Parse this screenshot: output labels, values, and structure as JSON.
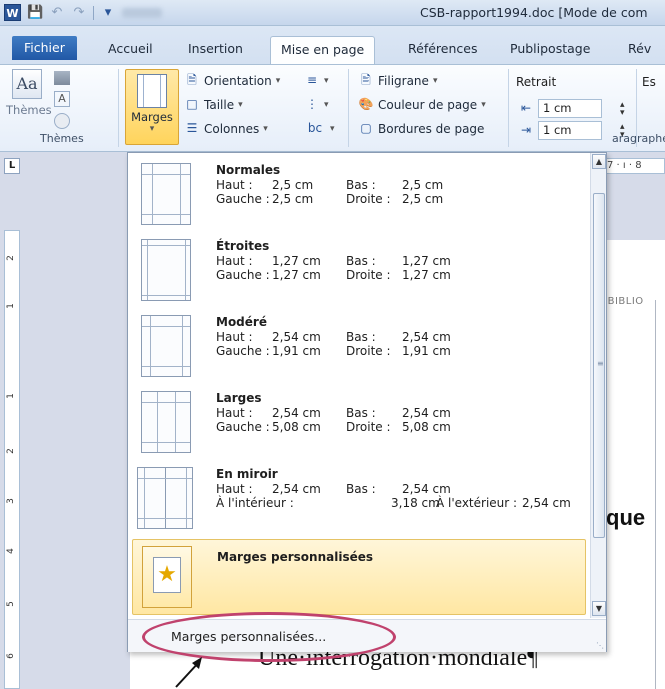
{
  "window": {
    "title": "CSB-rapport1994.doc [Mode de com"
  },
  "tabs": [
    {
      "label": "Fichier"
    },
    {
      "label": "Accueil"
    },
    {
      "label": "Insertion"
    },
    {
      "label": "Mise en page"
    },
    {
      "label": "Références"
    },
    {
      "label": "Publipostage"
    },
    {
      "label": "Rév"
    }
  ],
  "ribbon": {
    "themes_group": {
      "button": "Thèmes",
      "label": "Thèmes",
      "icon_text": "Aa",
      "small_a": "A"
    },
    "page_setup": {
      "marges": "Marges",
      "orientation": "Orientation",
      "taille": "Taille",
      "colonnes": "Colonnes",
      "hyphen_glyph": "bc"
    },
    "background": {
      "filigrane": "Filigrane",
      "couleur": "Couleur de page",
      "bordures": "Bordures de page"
    },
    "paragraph": {
      "retrait": "Retrait",
      "left_value": "1 cm",
      "right_value": "1 cm",
      "espacement_fragment": "Es",
      "group_label_fragment": "aragraphe"
    }
  },
  "ruler": {
    "corner": "L",
    "h_fragment": "7 · ı · 8",
    "v_numbers": [
      "2",
      "1",
      "1",
      "2",
      "3",
      "4",
      "5",
      "6"
    ]
  },
  "margins_menu": {
    "items": [
      {
        "name": "Normales",
        "top_label": "Haut :",
        "top": "2,5 cm",
        "bottom_label": "Bas :",
        "bottom": "2,5 cm",
        "left_label": "Gauche :",
        "left": "2,5 cm",
        "right_label": "Droite :",
        "right": "2,5 cm"
      },
      {
        "name": "Étroites",
        "top_label": "Haut :",
        "top": "1,27 cm",
        "bottom_label": "Bas :",
        "bottom": "1,27 cm",
        "left_label": "Gauche :",
        "left": "1,27 cm",
        "right_label": "Droite :",
        "right": "1,27 cm"
      },
      {
        "name": "Modéré",
        "top_label": "Haut :",
        "top": "2,54 cm",
        "bottom_label": "Bas :",
        "bottom": "2,54 cm",
        "left_label": "Gauche :",
        "left": "1,91 cm",
        "right_label": "Droite :",
        "right": "1,91 cm"
      },
      {
        "name": "Larges",
        "top_label": "Haut :",
        "top": "2,54 cm",
        "bottom_label": "Bas :",
        "bottom": "2,54 cm",
        "left_label": "Gauche :",
        "left": "5,08 cm",
        "right_label": "Droite :",
        "right": "5,08 cm"
      },
      {
        "name": "En miroir",
        "top_label": "Haut :",
        "top": "2,54 cm",
        "bottom_label": "Bas :",
        "bottom": "2,54 cm",
        "left_label": "À l'intérieur :",
        "left": "3,18 cm",
        "right_label": "À l'extérieur :",
        "right": "2,54 cm"
      }
    ],
    "custom_item": "Marges personnalisées",
    "footer_link": "Marges personnalisées..."
  },
  "document": {
    "header_fragment": "S-BIBLIO",
    "heading_fragment": "que",
    "line": "Une·interrogation·mondiale¶"
  },
  "colors": {
    "accent": "#2158a6",
    "highlight": "#ffd45c",
    "annotation": "#c0426d"
  }
}
